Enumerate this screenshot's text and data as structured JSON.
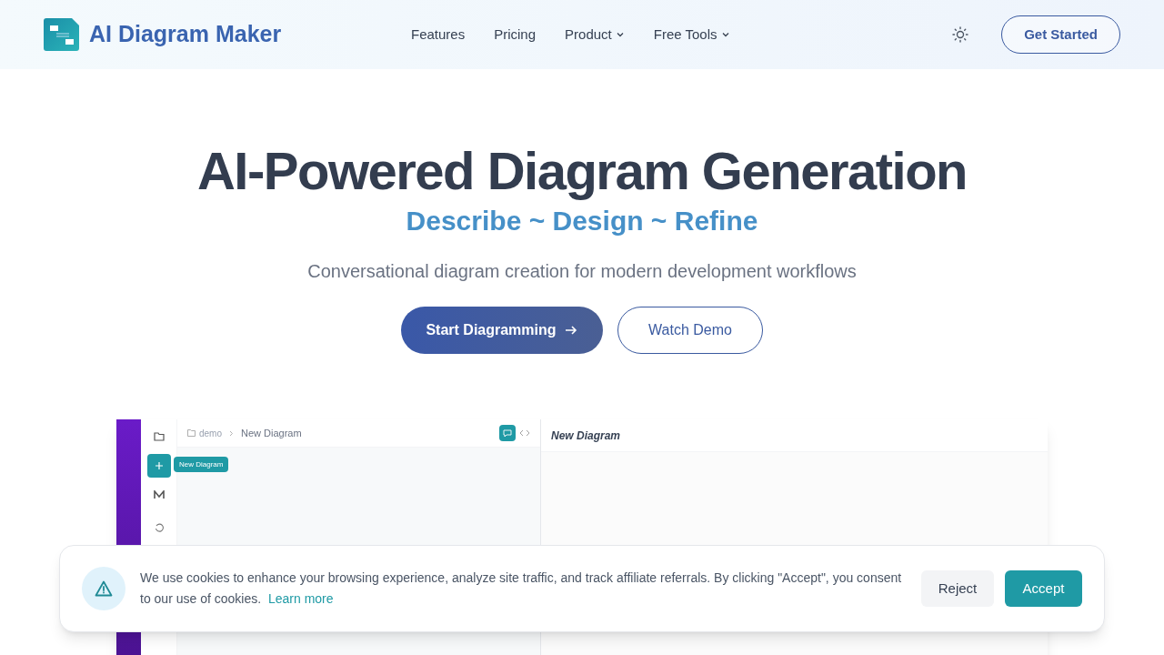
{
  "header": {
    "logo_text": "AI Diagram Maker",
    "nav": [
      {
        "label": "Features",
        "kind": "link"
      },
      {
        "label": "Pricing",
        "kind": "link"
      },
      {
        "label": "Product",
        "kind": "dropdown"
      },
      {
        "label": "Free Tools",
        "kind": "dropdown"
      }
    ],
    "cta": "Get Started"
  },
  "hero": {
    "title": "AI-Powered Diagram Generation",
    "tagline": "Describe ~ Design ~ Refine",
    "description": "Conversational diagram creation for modern development workflows",
    "primary_button": "Start Diagramming",
    "secondary_button": "Watch Demo"
  },
  "app_preview": {
    "breadcrumb_folder": "demo",
    "breadcrumb_page": "New Diagram",
    "tooltip": "New Diagram",
    "panel_title": "New Diagram"
  },
  "cookie_banner": {
    "text": "We use cookies to enhance your browsing experience, analyze site traffic, and track affiliate referrals. By clicking \"Accept\", you consent to our use of cookies.",
    "link": "Learn more",
    "buttons": [
      {
        "label": "Reject",
        "kind": "secondary"
      },
      {
        "label": "Accept",
        "kind": "primary"
      }
    ]
  }
}
